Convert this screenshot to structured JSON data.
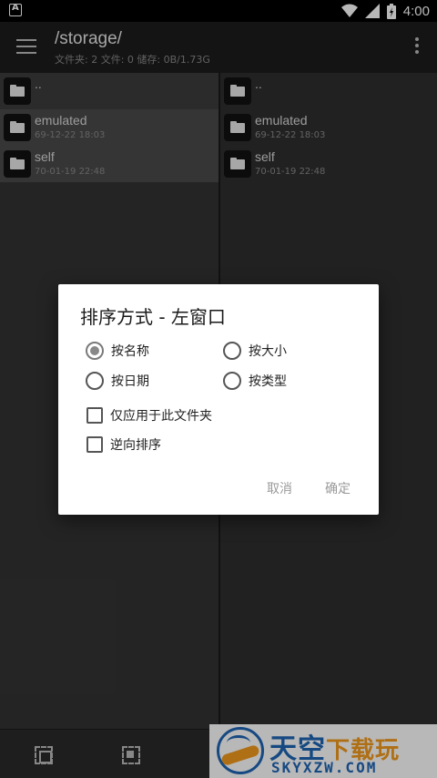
{
  "status_bar": {
    "time": "4:00",
    "notification_glyph": "A"
  },
  "app_bar": {
    "title": "/storage/",
    "stats": "文件夹: 2  文件: 0  储存: 0B/1.73G"
  },
  "left_pane": {
    "items": [
      {
        "name": "..",
        "date": ""
      },
      {
        "name": "emulated",
        "date": "69-12-22 18:03"
      },
      {
        "name": "self",
        "date": "70-01-19 22:48"
      }
    ]
  },
  "right_pane": {
    "items": [
      {
        "name": "..",
        "date": ""
      },
      {
        "name": "emulated",
        "date": "69-12-22 18:03"
      },
      {
        "name": "self",
        "date": "70-01-19 22:48"
      }
    ]
  },
  "dialog": {
    "title": "排序方式 - 左窗口",
    "sort_options": [
      {
        "label": "按名称",
        "selected": true
      },
      {
        "label": "按大小",
        "selected": false
      },
      {
        "label": "按日期",
        "selected": false
      },
      {
        "label": "按类型",
        "selected": false
      }
    ],
    "checkboxes": [
      {
        "label": "仅应用于此文件夹",
        "checked": false
      },
      {
        "label": "逆向排序",
        "checked": false
      }
    ],
    "cancel_label": "取消",
    "ok_label": "确定"
  },
  "watermark": {
    "title_main": "天空",
    "title_accent": "下载玩",
    "subtitle": "SKYXZW.COM"
  },
  "colors": {
    "accent_blue": "#1f66b5",
    "accent_orange": "#f39a1e",
    "dialog_button": "#9a9a9a"
  }
}
